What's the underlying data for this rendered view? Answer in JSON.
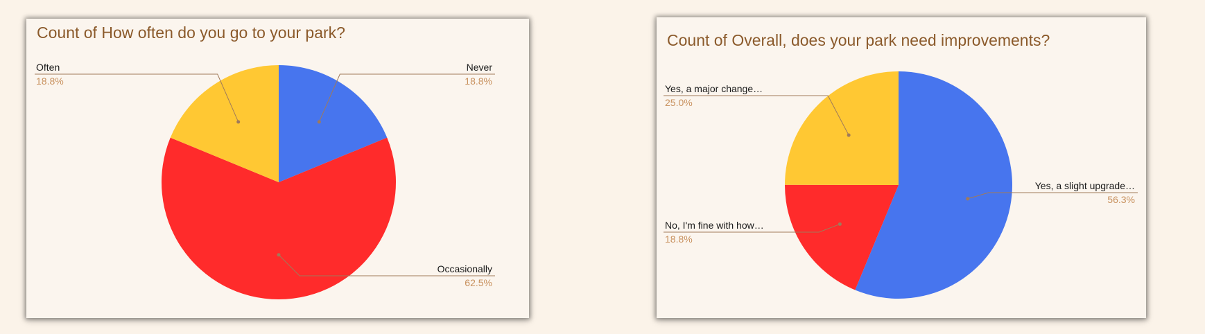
{
  "chart_data": [
    {
      "type": "pie",
      "title": "Count of How often do you go to your park?",
      "slices": [
        {
          "label": "Never",
          "value": 18.8,
          "display": "18.8%",
          "color": "#4775ee"
        },
        {
          "label": "Occasionally",
          "value": 62.5,
          "display": "62.5%",
          "color": "#ff2b2b"
        },
        {
          "label": "Often",
          "value": 18.8,
          "display": "18.8%",
          "color": "#ffc833"
        }
      ]
    },
    {
      "type": "pie",
      "title": "Count of Overall, does your park need improvements?",
      "slices": [
        {
          "label": "Yes, a slight upgrade…",
          "value": 56.3,
          "display": "56.3%",
          "color": "#4775ee"
        },
        {
          "label": "No, I'm fine with how…",
          "value": 18.8,
          "display": "18.8%",
          "color": "#ff2b2b"
        },
        {
          "label": "Yes, a major change…",
          "value": 25.0,
          "display": "25.0%",
          "color": "#ffc833"
        }
      ]
    }
  ]
}
